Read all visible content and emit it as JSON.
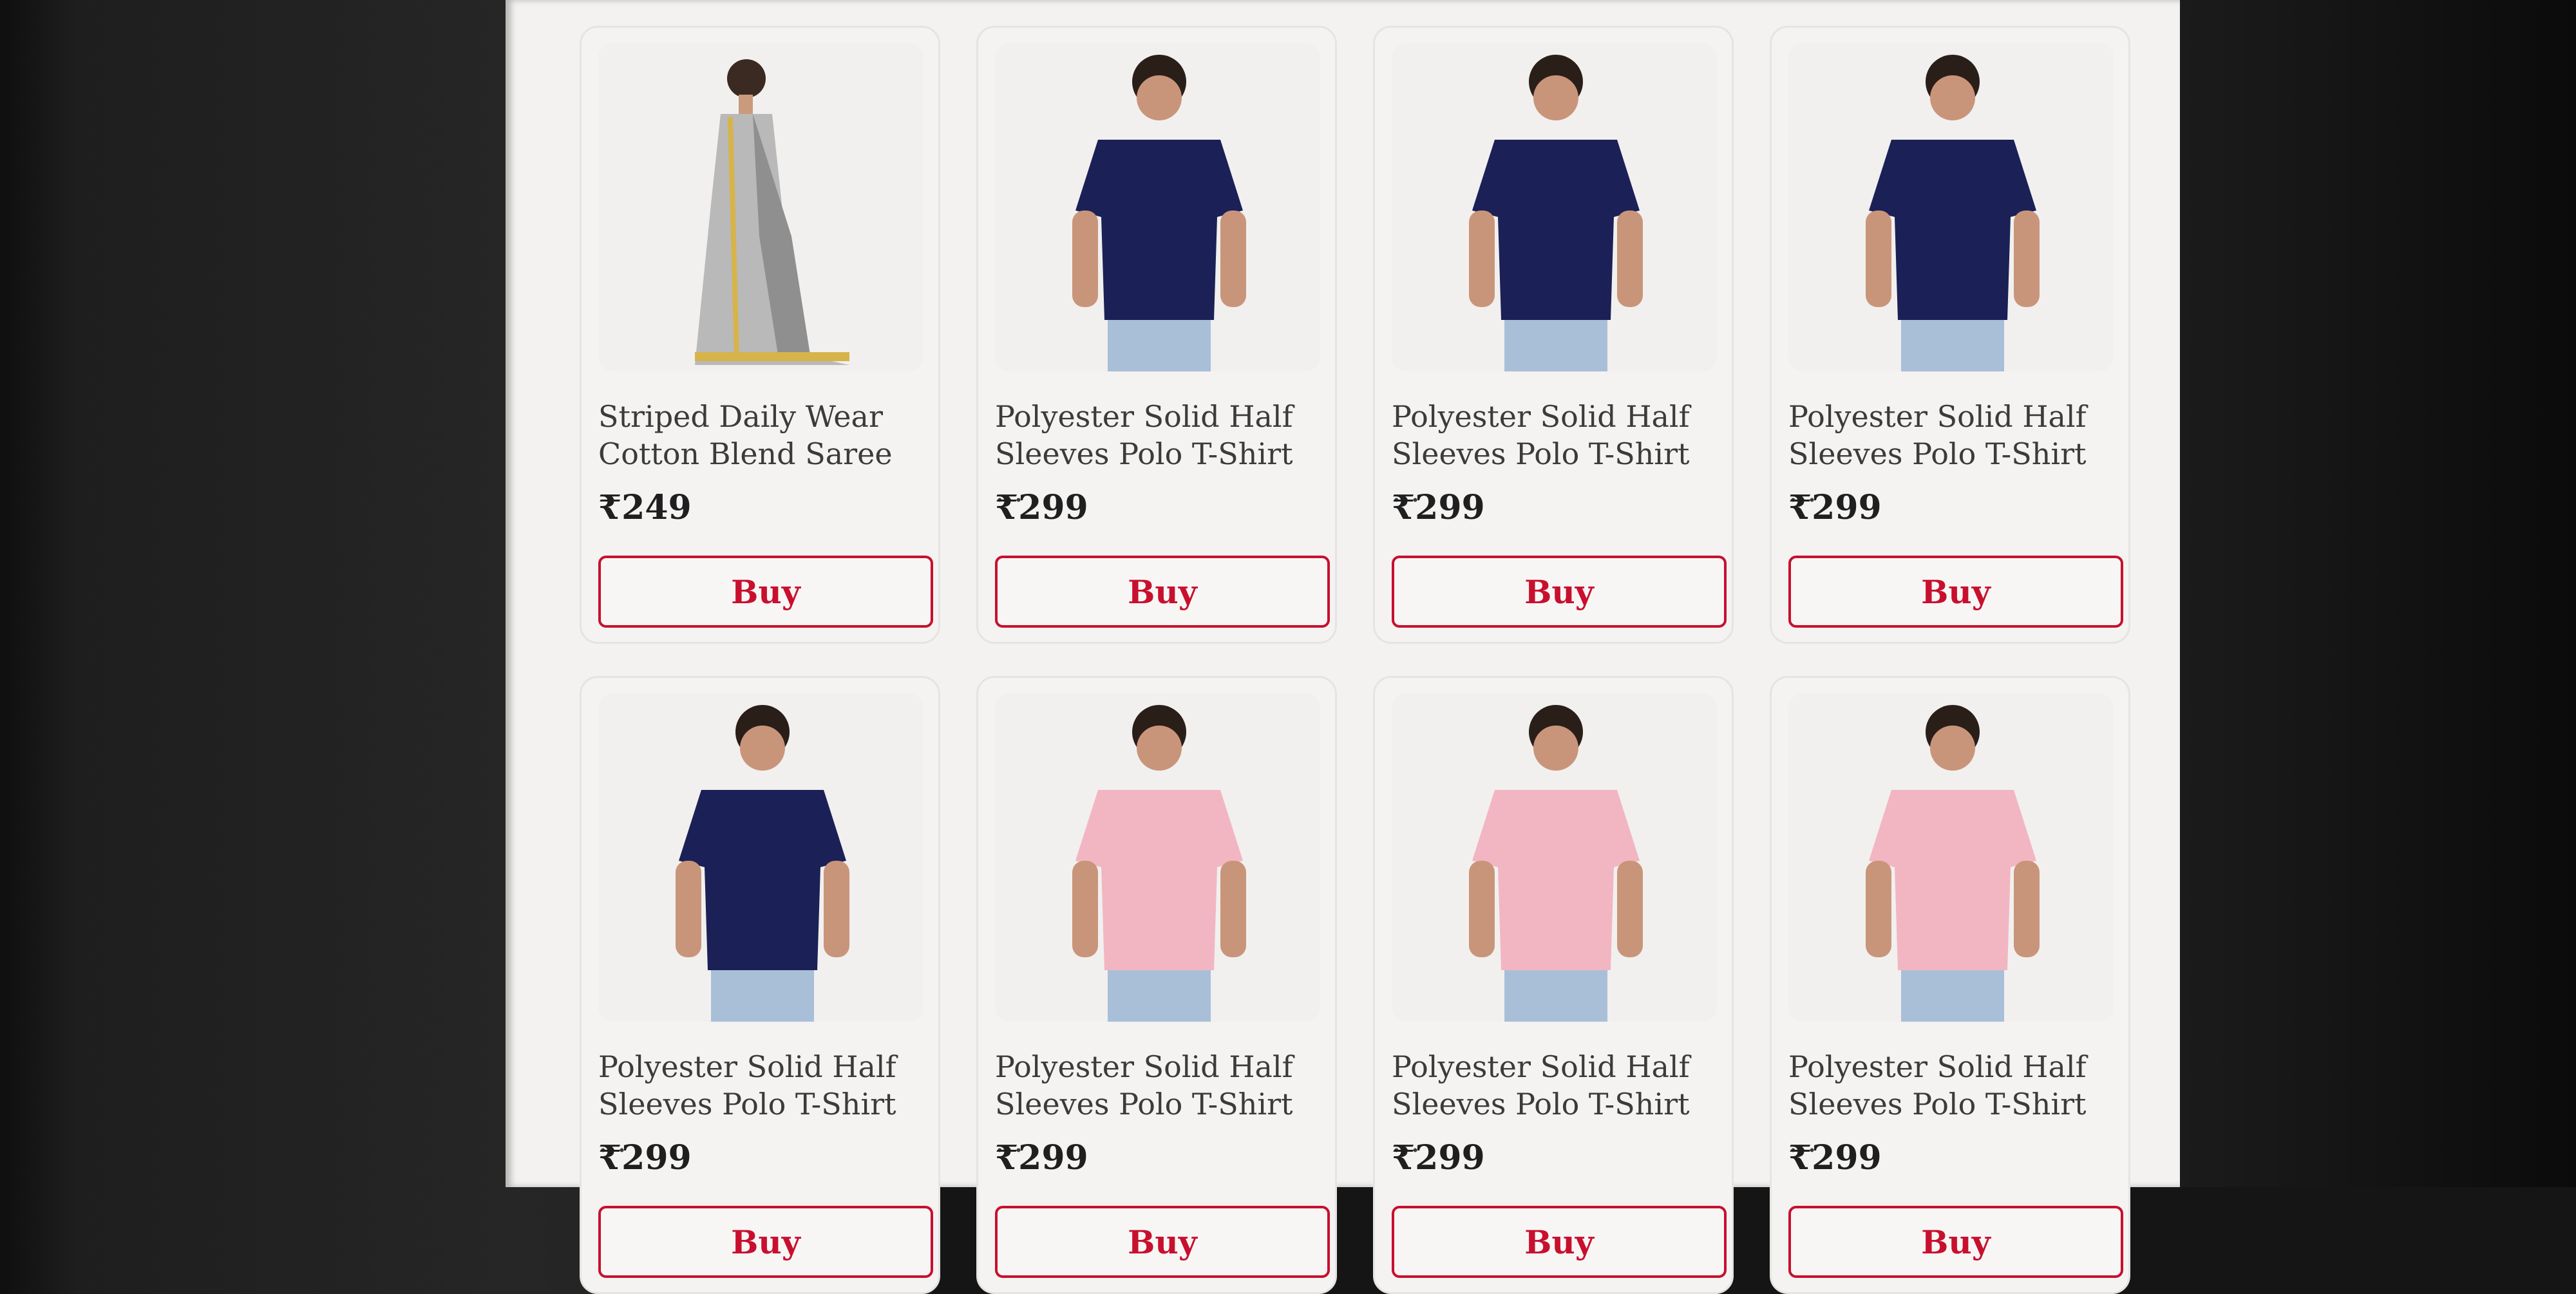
{
  "products": [
    {
      "title": "Striped Daily Wear\nCotton Blend Saree",
      "price": "₹249",
      "buy_label": "Buy",
      "image": "saree-grey",
      "color": "#9a9a9a"
    },
    {
      "title": "Polyester Solid Half\nSleeves Polo T-Shirt ...",
      "price": "₹299",
      "buy_label": "Buy",
      "image": "polo-navy",
      "color": "#1b2156"
    },
    {
      "title": "Polyester Solid Half\nSleeves Polo T-Shirt ...",
      "price": "₹299",
      "buy_label": "Buy",
      "image": "polo-navy",
      "color": "#1b2156"
    },
    {
      "title": "Polyester Solid Half\nSleeves Polo T-Shirt ...",
      "price": "₹299",
      "buy_label": "Buy",
      "image": "polo-navy",
      "color": "#1b2156"
    },
    {
      "title": "Polyester Solid Half\nSleeves Polo T-Shirt ...",
      "price": "₹299",
      "buy_label": "Buy",
      "image": "polo-navy",
      "color": "#1b2156"
    },
    {
      "title": "Polyester Solid Half\nSleeves Polo T-Shirt ...",
      "price": "₹299",
      "buy_label": "Buy",
      "image": "polo-pink",
      "color": "#f2b6c2"
    },
    {
      "title": "Polyester Solid Half\nSleeves Polo T-Shirt ...",
      "price": "₹299",
      "buy_label": "Buy",
      "image": "polo-pink",
      "color": "#f2b6c2"
    },
    {
      "title": "Polyester Solid Half\nSleeves Polo T-Shirt ...",
      "price": "₹299",
      "buy_label": "Buy",
      "image": "polo-pink",
      "color": "#f2b6c2"
    }
  ],
  "colors": {
    "accent": "#c8102e",
    "screen_bg": "#f3f2f1"
  }
}
